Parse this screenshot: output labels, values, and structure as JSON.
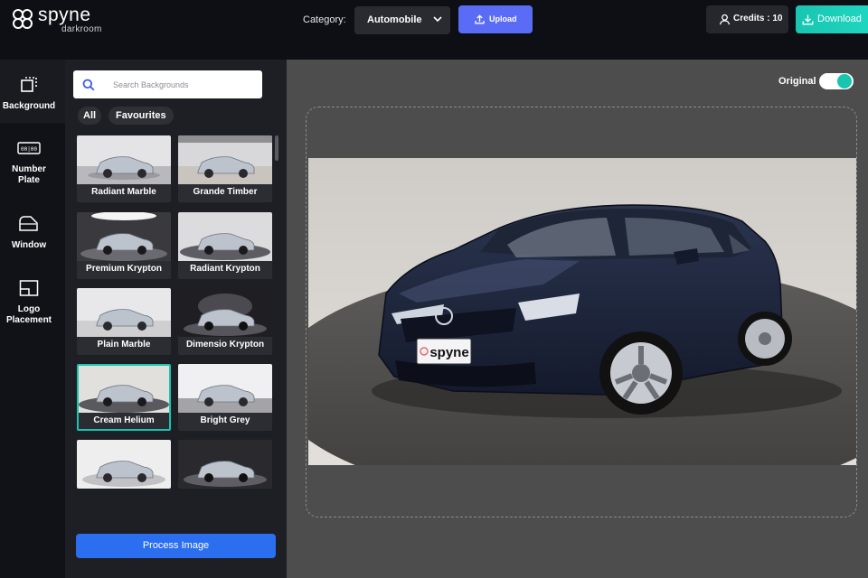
{
  "brand": {
    "name": "spyne",
    "sub": "darkroom"
  },
  "header": {
    "category_label": "Category:",
    "category_value": "Automobile",
    "upload_label": "Upload",
    "credits_label": "Credits : 10",
    "download_label": "Download"
  },
  "nav": {
    "items": [
      {
        "label": "Background",
        "icon": "background-icon"
      },
      {
        "label": "Number Plate",
        "icon": "number-plate-icon"
      },
      {
        "label": "Window",
        "icon": "window-icon"
      },
      {
        "label": "Logo Placement",
        "icon": "logo-placement-icon"
      }
    ]
  },
  "panel": {
    "search_placeholder": "Search Backgrounds",
    "filters": [
      "All",
      "Favourites"
    ],
    "backgrounds": [
      {
        "label": "Radiant Marble"
      },
      {
        "label": "Grande Timber"
      },
      {
        "label": "Premium Krypton"
      },
      {
        "label": "Radiant Krypton"
      },
      {
        "label": "Plain Marble"
      },
      {
        "label": "Dimensio Krypton"
      },
      {
        "label": "Cream Helium",
        "selected": true
      },
      {
        "label": "Bright Grey"
      },
      {
        "label": ""
      },
      {
        "label": ""
      }
    ],
    "process_label": "Process Image"
  },
  "canvas": {
    "toggle_label": "Original",
    "toggle_on": true,
    "plate_text": "spyne"
  },
  "colors": {
    "accent": "#18c5b0",
    "upload": "#5a6cf6",
    "process": "#2b6ef0"
  }
}
